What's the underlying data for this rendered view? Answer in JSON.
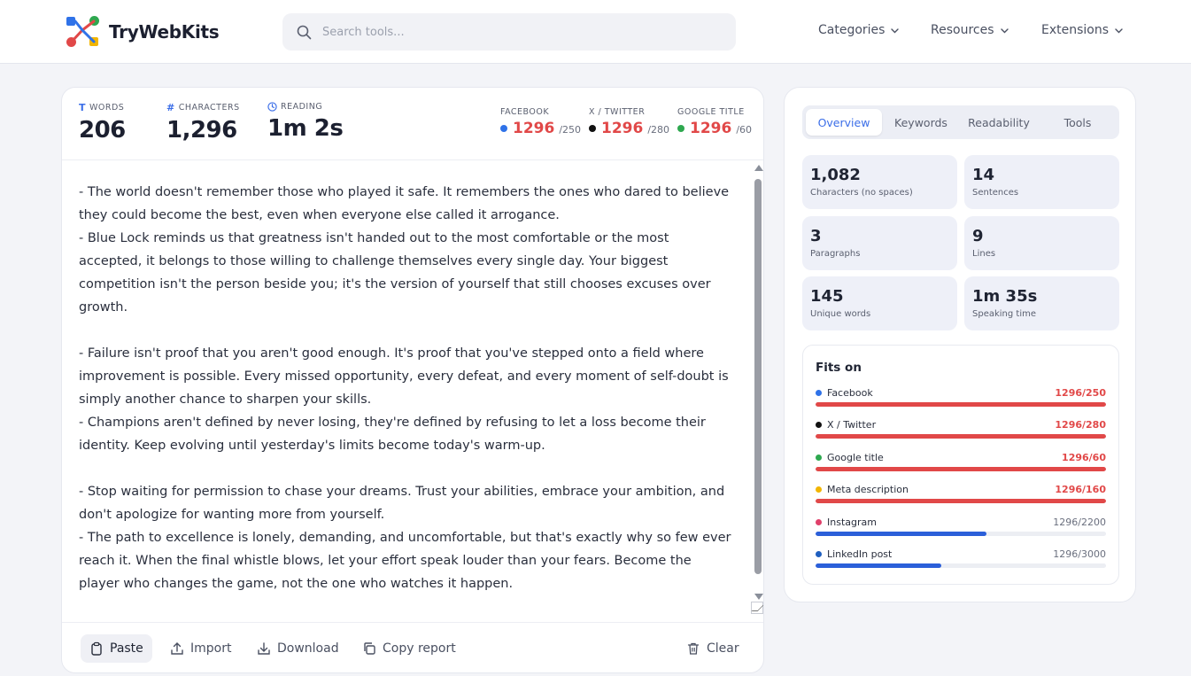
{
  "header": {
    "logo_text": "TryWebKits",
    "search_placeholder": "Search tools...",
    "nav": [
      "Categories",
      "Resources",
      "Extensions"
    ]
  },
  "stats": [
    {
      "label": "WORDS",
      "value": "206",
      "icon": "T"
    },
    {
      "label": "CHARACTERS",
      "value": "1,296",
      "icon": "#"
    },
    {
      "label": "READING",
      "value": "1m 2s",
      "icon": "clock-icon"
    }
  ],
  "limits": [
    {
      "label": "FACEBOOK",
      "value": "1296",
      "max": "/250",
      "color": "#2f72e8"
    },
    {
      "label": "X / TWITTER",
      "value": "1296",
      "max": "/280",
      "color": "#111111"
    },
    {
      "label": "GOOGLE TITLE",
      "value": "1296",
      "max": "/60",
      "color": "#2ea84f"
    }
  ],
  "text_lines": [
    "- The world doesn't remember those who played it safe. It remembers the ones who dared to believe they could become the best, even when everyone else called it arrogance.",
    "- Blue Lock reminds us that greatness isn't handed out to the most comfortable or the most accepted, it belongs to those willing to challenge themselves every single day. Your biggest competition isn't the person beside you; it's the version of yourself that still chooses excuses over growth.",
    "",
    "- Failure isn't proof that you aren't good enough. It's proof that you've stepped onto a field where improvement is possible. Every missed opportunity, every defeat, and every moment of self-doubt is simply another chance to sharpen your skills.",
    "- Champions aren't defined by never losing, they're defined by refusing to let a loss become their identity. Keep evolving until yesterday's limits become today's warm-up.",
    "",
    "- Stop waiting for permission to chase your dreams. Trust your abilities, embrace your ambition, and don't apologize for wanting more from yourself.",
    "- The path to excellence is lonely, demanding, and uncomfortable, but that's exactly why so few ever reach it. When the final whistle blows, let your effort speak louder than your fears. Become the player who changes the game, not the one who watches it happen."
  ],
  "toolbar": {
    "paste": "Paste",
    "import": "Import",
    "download": "Download",
    "copy_report": "Copy report",
    "clear": "Clear"
  },
  "tabs": [
    "Overview",
    "Keywords",
    "Readability",
    "Tools"
  ],
  "metrics": [
    {
      "value": "1,082",
      "label": "Characters (no spaces)"
    },
    {
      "value": "14",
      "label": "Sentences"
    },
    {
      "value": "3",
      "label": "Paragraphs"
    },
    {
      "value": "9",
      "label": "Lines"
    },
    {
      "value": "145",
      "label": "Unique words"
    },
    {
      "value": "1m 35s",
      "label": "Speaking time"
    }
  ],
  "fits": {
    "title": "Fits on",
    "items": [
      {
        "name": "Facebook",
        "count": "1296/250",
        "over": true,
        "fill": 1.0,
        "dot": "#2f72e8"
      },
      {
        "name": "X / Twitter",
        "count": "1296/280",
        "over": true,
        "fill": 1.0,
        "dot": "#111111"
      },
      {
        "name": "Google title",
        "count": "1296/60",
        "over": true,
        "fill": 1.0,
        "dot": "#2ea84f"
      },
      {
        "name": "Meta description",
        "count": "1296/160",
        "over": true,
        "fill": 1.0,
        "dot": "#f2b500"
      },
      {
        "name": "Instagram",
        "count": "1296/2200",
        "over": false,
        "fill": 0.589,
        "dot": "#e0406a"
      },
      {
        "name": "LinkedIn post",
        "count": "1296/3000",
        "over": false,
        "fill": 0.432,
        "dot": "#1f5fbf"
      }
    ]
  },
  "colors": {
    "over": "#e14848",
    "ok": "#2b5fd9",
    "accent": "#3b6ee8"
  }
}
